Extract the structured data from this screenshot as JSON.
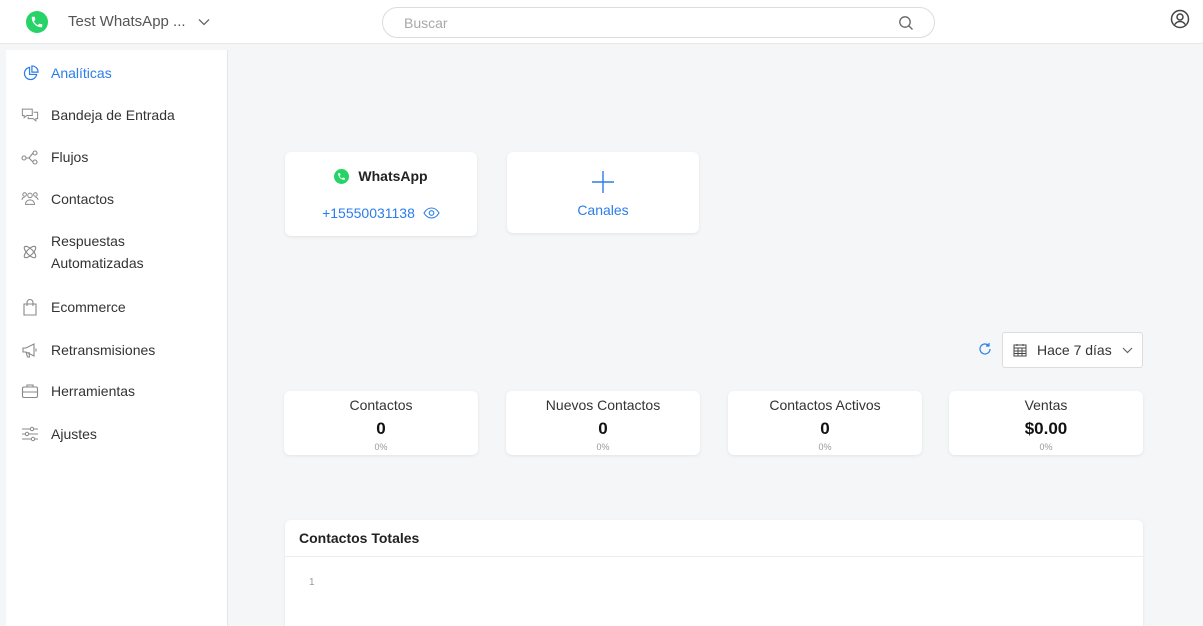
{
  "header": {
    "account_name": "Test WhatsApp ...",
    "search_placeholder": "Buscar"
  },
  "sidebar": {
    "items": [
      {
        "label": "Analíticas",
        "icon": "pie-chart-icon",
        "active": true
      },
      {
        "label": "Bandeja de Entrada",
        "icon": "chat-bubbles-icon"
      },
      {
        "label": "Flujos",
        "icon": "flow-icon"
      },
      {
        "label": "Contactos",
        "icon": "contacts-icon"
      },
      {
        "label": "Respuestas Automatizadas",
        "icon": "atom-icon"
      },
      {
        "label": "Ecommerce",
        "icon": "shopping-bag-icon"
      },
      {
        "label": "Retransmisiones",
        "icon": "megaphone-icon"
      },
      {
        "label": "Herramientas",
        "icon": "toolbox-icon"
      },
      {
        "label": "Ajustes",
        "icon": "sliders-icon"
      }
    ]
  },
  "channels": {
    "whatsapp": {
      "title": "WhatsApp",
      "phone": "+15550031138"
    },
    "add_label": "Canales"
  },
  "filters": {
    "date_range": "Hace 7 días"
  },
  "stats": [
    {
      "label": "Contactos",
      "value": "0",
      "change": "0%"
    },
    {
      "label": "Nuevos Contactos",
      "value": "0",
      "change": "0%"
    },
    {
      "label": "Contactos Activos",
      "value": "0",
      "change": "0%"
    },
    {
      "label": "Ventas",
      "value": "$0.00",
      "change": "0%"
    }
  ],
  "totals_chart": {
    "title": "Contactos Totales",
    "y_tick": "1"
  },
  "colors": {
    "accent": "#2b7de9",
    "whatsapp": "#25d366"
  }
}
